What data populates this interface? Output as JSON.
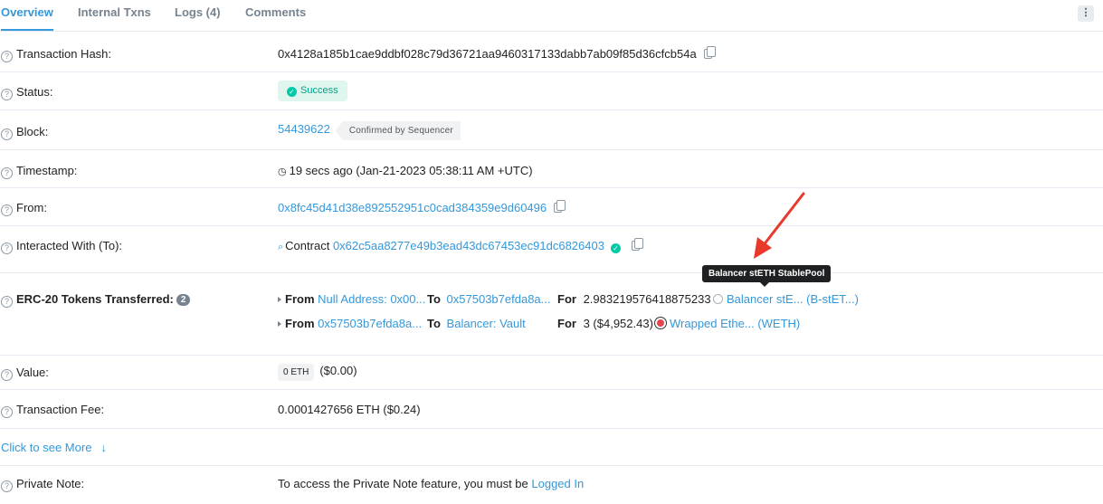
{
  "tabs": {
    "overview": "Overview",
    "internal": "Internal Txns",
    "logs": "Logs (4)",
    "comments": "Comments"
  },
  "menu_icon": "⋮",
  "labels": {
    "hash": "Transaction Hash:",
    "status": "Status:",
    "block": "Block:",
    "timestamp": "Timestamp:",
    "from": "From:",
    "to": "Interacted With (To):",
    "erc20": "ERC-20 Tokens Transferred:",
    "value": "Value:",
    "fee": "Transaction Fee:",
    "private_note": "Private Note:"
  },
  "tx": {
    "hash": "0x4128a185b1cae9ddbf028c79d36721aa9460317133dabb7ab09f85d36cfcb54a",
    "status": "Success",
    "block": "54439622",
    "block_confirm": "Confirmed by Sequencer",
    "timestamp": "19 secs ago (Jan-21-2023 05:38:11 AM +UTC)",
    "from": "0x8fc45d41d38e892552951c0cad384359e9d60496",
    "to_prefix": "Contract",
    "to": "0x62c5aa8277e49b3ead43dc67453ec91dc6826403",
    "erc20_count": "2",
    "value_badge": "0 ETH",
    "value_usd": "($0.00)",
    "fee": "0.0001427656 ETH ($0.24)"
  },
  "transfers": [
    {
      "from_label": "From",
      "from": "Null Address: 0x00...",
      "to_label": "To",
      "to": "0x57503b7efda8a...",
      "for_label": "For",
      "amount": "2.983219576418875233",
      "token": "Balancer stE... (B-stET...)"
    },
    {
      "from_label": "From",
      "from": "0x57503b7efda8a...",
      "to_label": "To",
      "to": "Balancer: Vault",
      "for_label": "For",
      "amount": "3 ($4,952.43)",
      "token": "Wrapped Ethe... (WETH)"
    }
  ],
  "tooltip": "Balancer stETH StablePool",
  "more": {
    "text": "Click to see More",
    "arrow": "↓"
  },
  "private_note": {
    "text": "To access the Private Note feature, you must be ",
    "link": "Logged In"
  },
  "colors": {
    "link": "#3498db",
    "success_bg": "#dff6ef",
    "success_fg": "#00a186",
    "annotation_arrow": "#e8392b"
  }
}
